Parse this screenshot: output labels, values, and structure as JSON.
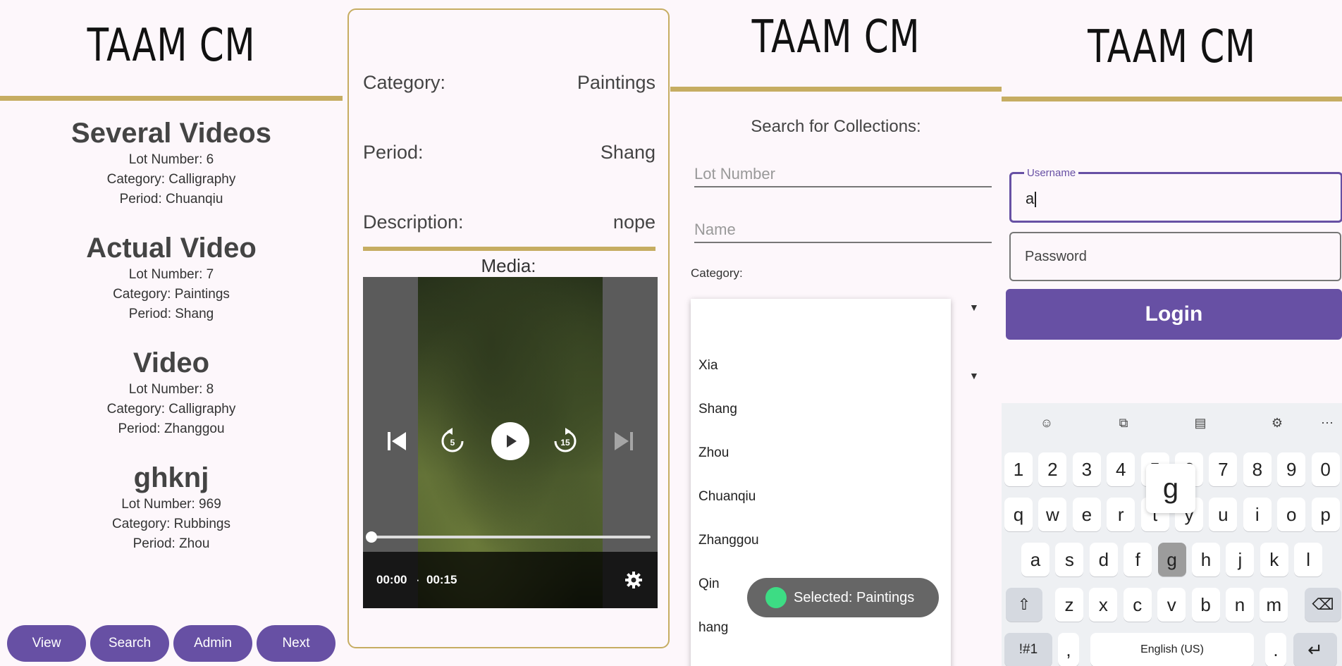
{
  "app_title": "TAAM CM",
  "browse": {
    "collections": [
      {
        "name": "Several Videos",
        "lot": "Lot Number: 6",
        "category": "Category: Calligraphy",
        "period": "Period: Chuanqiu"
      },
      {
        "name": "Actual Video",
        "lot": "Lot Number: 7",
        "category": "Category: Paintings",
        "period": "Period: Shang"
      },
      {
        "name": "Video",
        "lot": "Lot Number: 8",
        "category": "Category: Calligraphy",
        "period": "Period: Zhanggou"
      },
      {
        "name": "ghknj",
        "lot": "Lot Number: 969",
        "category": "Category: Rubbings",
        "period": "Period: Zhou"
      }
    ],
    "nav": [
      "View",
      "Search",
      "Admin",
      "Next"
    ]
  },
  "detail": {
    "category_label": "Category:",
    "category_value": "Paintings",
    "period_label": "Period:",
    "period_value": "Shang",
    "description_label": "Description:",
    "description_value": "nope",
    "media_label": "Media:",
    "player": {
      "current": "00:00",
      "separator": "·",
      "duration": "00:15",
      "rewind": "5",
      "forward": "15",
      "progress": 0
    }
  },
  "search": {
    "heading": "Search for Collections:",
    "lot_placeholder": "Lot Number",
    "name_placeholder": "Name",
    "category_label": "Category:",
    "dropdown_items": [
      "Xia",
      "Shang",
      "Zhou",
      "Chuanqiu",
      "Zhanggou",
      "Qin",
      "hang"
    ],
    "toast": "Selected: Paintings"
  },
  "login": {
    "username_label": "Username",
    "username_value": "a",
    "password_placeholder": "Password",
    "login_label": "Login",
    "keyboard": {
      "numbers": [
        "1",
        "2",
        "3",
        "4",
        "5",
        "6",
        "7",
        "8",
        "9",
        "0"
      ],
      "row1": [
        "q",
        "w",
        "e",
        "r",
        "t",
        "y",
        "u",
        "i",
        "o",
        "p"
      ],
      "row2": [
        "a",
        "s",
        "d",
        "f",
        "g",
        "h",
        "j",
        "k",
        "l"
      ],
      "row3": [
        "z",
        "x",
        "c",
        "v",
        "b",
        "n",
        "m"
      ],
      "popup": "g",
      "symbols": "!#1",
      "comma": ",",
      "space": "English (US)",
      "period": "."
    }
  }
}
